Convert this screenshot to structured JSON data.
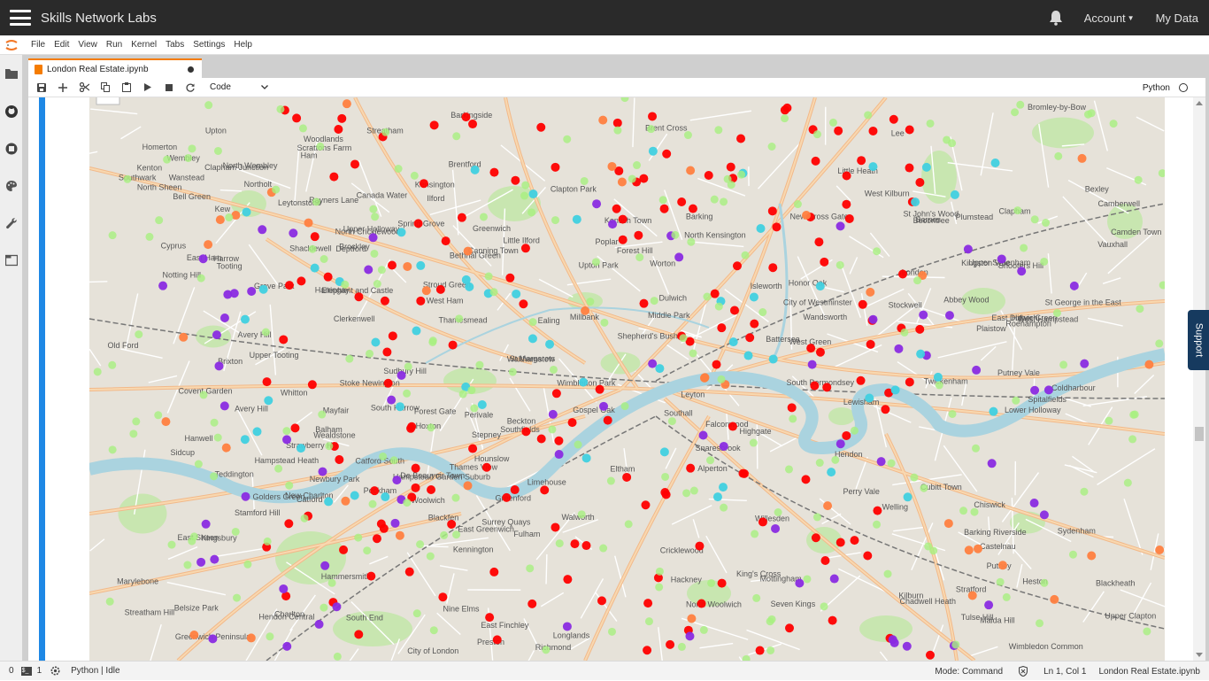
{
  "header": {
    "brand": "Skills Network Labs",
    "account_label": "Account",
    "mydata_label": "My Data",
    "icons": [
      "hamburger-icon",
      "bell-icon",
      "caret-down-icon"
    ]
  },
  "menu": {
    "items": [
      "File",
      "Edit",
      "View",
      "Run",
      "Kernel",
      "Tabs",
      "Settings",
      "Help"
    ]
  },
  "sidebar": {
    "icons": [
      "folder-icon",
      "github-icon",
      "running-icon",
      "palette-icon",
      "wrench-icon",
      "tabs-icon"
    ]
  },
  "tab": {
    "title": "London Real Estate.ipynb"
  },
  "toolbar": {
    "cell_type": "Code",
    "kernel": "Python",
    "icons": [
      "save-icon",
      "add-icon",
      "cut-icon",
      "copy-icon",
      "paste-icon",
      "run-icon",
      "stop-icon",
      "restart-icon"
    ]
  },
  "map": {
    "places": [
      "Wealdstone",
      "Hendon",
      "East Finchley",
      "West Green",
      "Barkingside",
      "Little Heath",
      "Harrow",
      "Kenton",
      "Kingsbury",
      "Hendon Central",
      "Hampstead Garden Suburb",
      "Highgate",
      "Harringay",
      "Walthamstow",
      "Snaresbrook",
      "Wanstead",
      "Newbury Park",
      "Chadwell Heath",
      "Rayners Lane",
      "Preston",
      "Brent Cross",
      "Golders Green",
      "Stroud Green",
      "Stamford Hill",
      "Leytonstone",
      "Leyton",
      "Seven Kings",
      "South Harrow",
      "North Wembley",
      "Cricklewood",
      "North Cricklewood",
      "Hampstead Heath",
      "Upper Holloway",
      "Upper Clapton",
      "Sudbury Hill",
      "Wembley",
      "West Hampstead",
      "Gospel Oak",
      "Lower Holloway",
      "Stoke Newington",
      "Clapton Park",
      "Ilford",
      "Little Ilford",
      "Becontree",
      "Northolt",
      "Willesden",
      "Belsize Park",
      "Kentish Town",
      "Shacklewell",
      "Homerton",
      "Stratford",
      "Forest Gate",
      "Hackney",
      "Upton",
      "Upton Park",
      "Barking",
      "Alperton",
      "Kilburn",
      "Camden Town",
      "De Beauvoir Town",
      "Perivale",
      "Greenford",
      "West Kilburn",
      "St John's Wood",
      "King's Cross",
      "Clerkenwell",
      "Hoxton",
      "Bethnal Green",
      "Old Ford",
      "Bromley-by-Bow",
      "West Ham",
      "Plaistow",
      "East Ham",
      "Thames View",
      "Scrattons Farm",
      "Maida Hill",
      "Marylebone",
      "Spitalfields",
      "Stepney",
      "Canning Town",
      "Barking Riverside",
      "North Kensington",
      "City of London",
      "Limehouse",
      "Poplar",
      "Beckton",
      "Ealing",
      "Hanwell",
      "Southall",
      "Notting Hill",
      "Shepherd's Bush",
      "Covent Garden",
      "Mayfair",
      "London",
      "St George in the East",
      "Cyprus",
      "Kensington",
      "City of Westminster",
      "Southwark",
      "Elephant and Castle",
      "Canada Water",
      "Greenwich Peninsula",
      "North Woolwich",
      "Thamesmead",
      "Chiswick",
      "Hammersmith",
      "Millbank",
      "Walworth",
      "Surrey Quays",
      "Cubitt Town",
      "New Charlton",
      "Brentford",
      "Heston",
      "Castelnau",
      "Vauxhall",
      "Kennington",
      "South Bermondsey",
      "East Greenwich",
      "Greenwich",
      "Charlton",
      "Woolwich",
      "Abbey Wood",
      "Kew",
      "Spring Grove",
      "Fulham",
      "Nine Elms",
      "Camberwell",
      "Peckham",
      "New Cross Gate",
      "Deptford",
      "Plumstead",
      "Barnes",
      "Hounslow",
      "Woodlands",
      "Isleworth",
      "North Sheen",
      "Battersea",
      "Stockwell",
      "Blackheath",
      "Shooters Hill",
      "Worton",
      "Richmond",
      "East Sheen",
      "Putney",
      "Clapham Junction",
      "Clapham",
      "Lewisham",
      "Welling",
      "St Margarets",
      "Wandsworth",
      "Brixton",
      "East Dulwich",
      "Brockley",
      "Lee",
      "Falconwood",
      "Whitton",
      "Roehampton",
      "Honor Oak",
      "Hither Green",
      "Eltham",
      "Avery Hill",
      "Twickenham",
      "Southfields",
      "Balham",
      "Tulse Hill",
      "Dulwich",
      "Catford",
      "Middle Park",
      "Strawberry Hill",
      "Putney Vale",
      "Wimbledon Park",
      "Streatham Hill",
      "Forest Hill",
      "Catford South",
      "Upper Tooting",
      "Perry Vale",
      "Mottingham",
      "Ham",
      "Kingston Vale",
      "Upper Sydenham",
      "Bell Green",
      "Grove Park",
      "Coldharbour",
      "Longlands",
      "Blackfen",
      "Wimbledon Common",
      "Tooting",
      "Streatham",
      "Teddington",
      "Sydenham",
      "South End",
      "Sidcup",
      "Bexley",
      "Avery Hill"
    ],
    "marker_colors": {
      "red": "#ff0000",
      "orange": "#ff8040",
      "purple": "#8a2be2",
      "cyan": "#40d0e0",
      "lightgreen": "#a8f080"
    }
  },
  "support_label": "Support",
  "status": {
    "left_count": "0",
    "terminal_count": "1",
    "kernel_status": "Python | Idle",
    "mode": "Mode: Command",
    "position": "Ln 1, Col 1",
    "filename": "London Real Estate.ipynb"
  }
}
